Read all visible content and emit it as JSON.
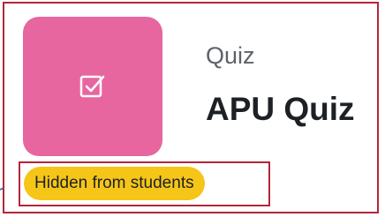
{
  "activity": {
    "type_label": "Quiz",
    "name": "APU Quiz",
    "icon": "quiz-checkbox-icon",
    "icon_color": "#e8669f"
  },
  "visibility_badge": {
    "label": "Hidden from students",
    "color": "#f5c518"
  },
  "highlight_color": "#b3263a",
  "pointer_color": "#4a78b8"
}
